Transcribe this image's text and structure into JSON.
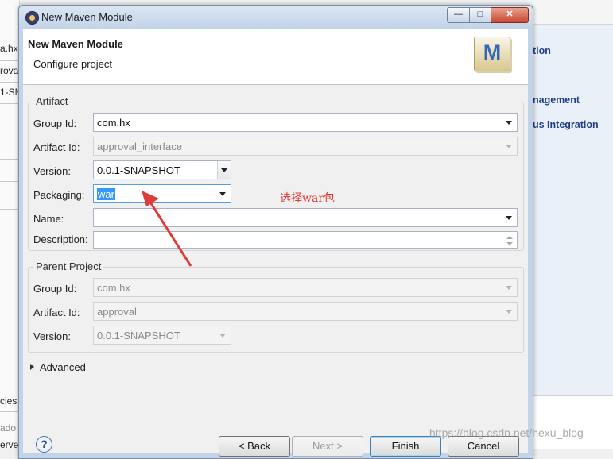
{
  "background": {
    "left_fragments": [
      "a.hx",
      "rova",
      "1-SN",
      "cies",
      "ado",
      "erve"
    ],
    "right_links": [
      "tion",
      "nagement",
      "us Integration"
    ]
  },
  "window": {
    "title": "New Maven Module",
    "controls": {
      "minimize": "—",
      "maximize": "□",
      "close": "✕"
    }
  },
  "header": {
    "title": "New Maven Module",
    "subtitle": "Configure project",
    "logo_letter": "M"
  },
  "artifact": {
    "section_label": "Artifact",
    "group_id": {
      "label": "Group Id:",
      "value": "com.hx"
    },
    "artifact_id": {
      "label": "Artifact Id:",
      "value": "approval_interface"
    },
    "version": {
      "label": "Version:",
      "value": "0.0.1-SNAPSHOT"
    },
    "packaging": {
      "label": "Packaging:",
      "value": "war"
    },
    "name": {
      "label": "Name:",
      "value": ""
    },
    "description": {
      "label": "Description:",
      "value": ""
    }
  },
  "parent": {
    "section_label": "Parent Project",
    "group_id": {
      "label": "Group Id:",
      "value": "com.hx"
    },
    "artifact_id": {
      "label": "Artifact Id:",
      "value": "approval"
    },
    "version": {
      "label": "Version:",
      "value": "0.0.1-SNAPSHOT"
    }
  },
  "advanced_label": "Advanced",
  "buttons": {
    "help": "?",
    "back": "< Back",
    "next": "Next >",
    "finish": "Finish",
    "cancel": "Cancel"
  },
  "annotation": "选择war包",
  "watermark": "https://blog.csdn.net/hexu_blog",
  "colors": {
    "annotation": "#e03a3a",
    "selection": "#3399ff",
    "titlebar": "#c3d4e8",
    "link": "#1e3f88"
  }
}
